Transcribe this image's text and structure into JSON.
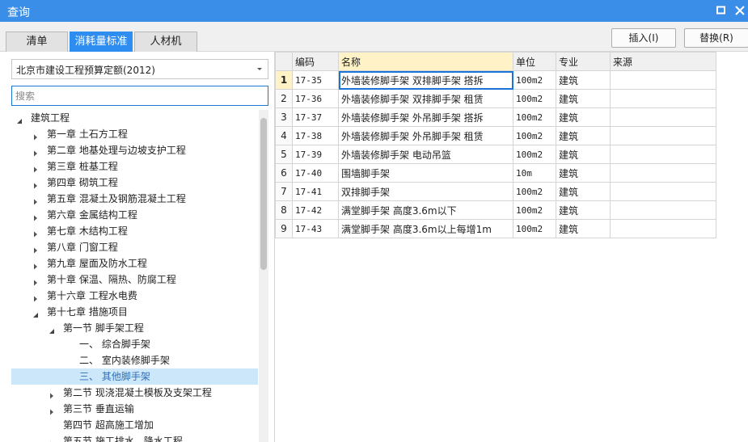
{
  "window": {
    "title": "查询"
  },
  "tabs": [
    {
      "label": "清单",
      "active": false
    },
    {
      "label": "消耗量标准",
      "active": true
    },
    {
      "label": "人材机",
      "active": false
    }
  ],
  "buttons": {
    "insert": "插入(I)",
    "replace": "替换(R)"
  },
  "left": {
    "dropdown_value": "北京市建设工程预算定额(2012)",
    "search_placeholder": "搜索"
  },
  "tree": [
    {
      "label": "建筑工程",
      "level": 0,
      "toggle": "expanded"
    },
    {
      "label": "第一章 土石方工程",
      "level": 1,
      "toggle": "collapsed"
    },
    {
      "label": "第二章 地基处理与边坡支护工程",
      "level": 1,
      "toggle": "collapsed"
    },
    {
      "label": "第三章 桩基工程",
      "level": 1,
      "toggle": "collapsed"
    },
    {
      "label": "第四章 砌筑工程",
      "level": 1,
      "toggle": "collapsed"
    },
    {
      "label": "第五章 混凝土及钢筋混凝土工程",
      "level": 1,
      "toggle": "collapsed"
    },
    {
      "label": "第六章 金属结构工程",
      "level": 1,
      "toggle": "collapsed"
    },
    {
      "label": "第七章 木结构工程",
      "level": 1,
      "toggle": "collapsed"
    },
    {
      "label": "第八章 门窗工程",
      "level": 1,
      "toggle": "collapsed"
    },
    {
      "label": "第九章 屋面及防水工程",
      "level": 1,
      "toggle": "collapsed"
    },
    {
      "label": "第十章 保温、隔热、防腐工程",
      "level": 1,
      "toggle": "collapsed"
    },
    {
      "label": "第十六章 工程水电费",
      "level": 1,
      "toggle": "collapsed"
    },
    {
      "label": "第十七章 措施项目",
      "level": 1,
      "toggle": "expanded"
    },
    {
      "label": "第一节 脚手架工程",
      "level": 2,
      "toggle": "expanded"
    },
    {
      "label": "一、 综合脚手架",
      "level": 3,
      "toggle": "none"
    },
    {
      "label": "二、 室内装修脚手架",
      "level": 3,
      "toggle": "none"
    },
    {
      "label": "三、 其他脚手架",
      "level": 3,
      "toggle": "none",
      "selected": true
    },
    {
      "label": "第二节 现浇混凝土模板及支架工程",
      "level": 2,
      "toggle": "collapsed"
    },
    {
      "label": "第三节 垂直运输",
      "level": 2,
      "toggle": "collapsed"
    },
    {
      "label": "第四节 超高施工增加",
      "level": 2,
      "toggle": "none"
    },
    {
      "label": "第五节 施工排水、降水工程",
      "level": 2,
      "toggle": "collapsed"
    }
  ],
  "table": {
    "columns": [
      "编码",
      "名称",
      "单位",
      "专业",
      "来源"
    ],
    "rows": [
      {
        "n": "1",
        "code": "17-35",
        "name": "外墙装修脚手架 双排脚手架 搭拆",
        "unit": "100m2",
        "spec": "建筑",
        "source": ""
      },
      {
        "n": "2",
        "code": "17-36",
        "name": "外墙装修脚手架 双排脚手架 租赁",
        "unit": "100m2",
        "spec": "建筑",
        "source": ""
      },
      {
        "n": "3",
        "code": "17-37",
        "name": "外墙装修脚手架 外吊脚手架 搭拆",
        "unit": "100m2",
        "spec": "建筑",
        "source": ""
      },
      {
        "n": "4",
        "code": "17-38",
        "name": "外墙装修脚手架 外吊脚手架 租赁",
        "unit": "100m2",
        "spec": "建筑",
        "source": ""
      },
      {
        "n": "5",
        "code": "17-39",
        "name": "外墙装修脚手架 电动吊篮",
        "unit": "100m2",
        "spec": "建筑",
        "source": ""
      },
      {
        "n": "6",
        "code": "17-40",
        "name": "围墙脚手架",
        "unit": "10m",
        "spec": "建筑",
        "source": ""
      },
      {
        "n": "7",
        "code": "17-41",
        "name": "双排脚手架",
        "unit": "100m2",
        "spec": "建筑",
        "source": ""
      },
      {
        "n": "8",
        "code": "17-42",
        "name": "满堂脚手架 高度3.6m以下",
        "unit": "100m2",
        "spec": "建筑",
        "source": ""
      },
      {
        "n": "9",
        "code": "17-43",
        "name": "满堂脚手架 高度3.6m以上每增1m",
        "unit": "100m2",
        "spec": "建筑",
        "source": ""
      }
    ]
  },
  "colors": {
    "titlebar": "#3b8ee8",
    "active_tab": "#2e8df0",
    "selection": "#cce6fa",
    "header_highlight": "#fff2c6",
    "focus_border": "#1a73d6"
  }
}
